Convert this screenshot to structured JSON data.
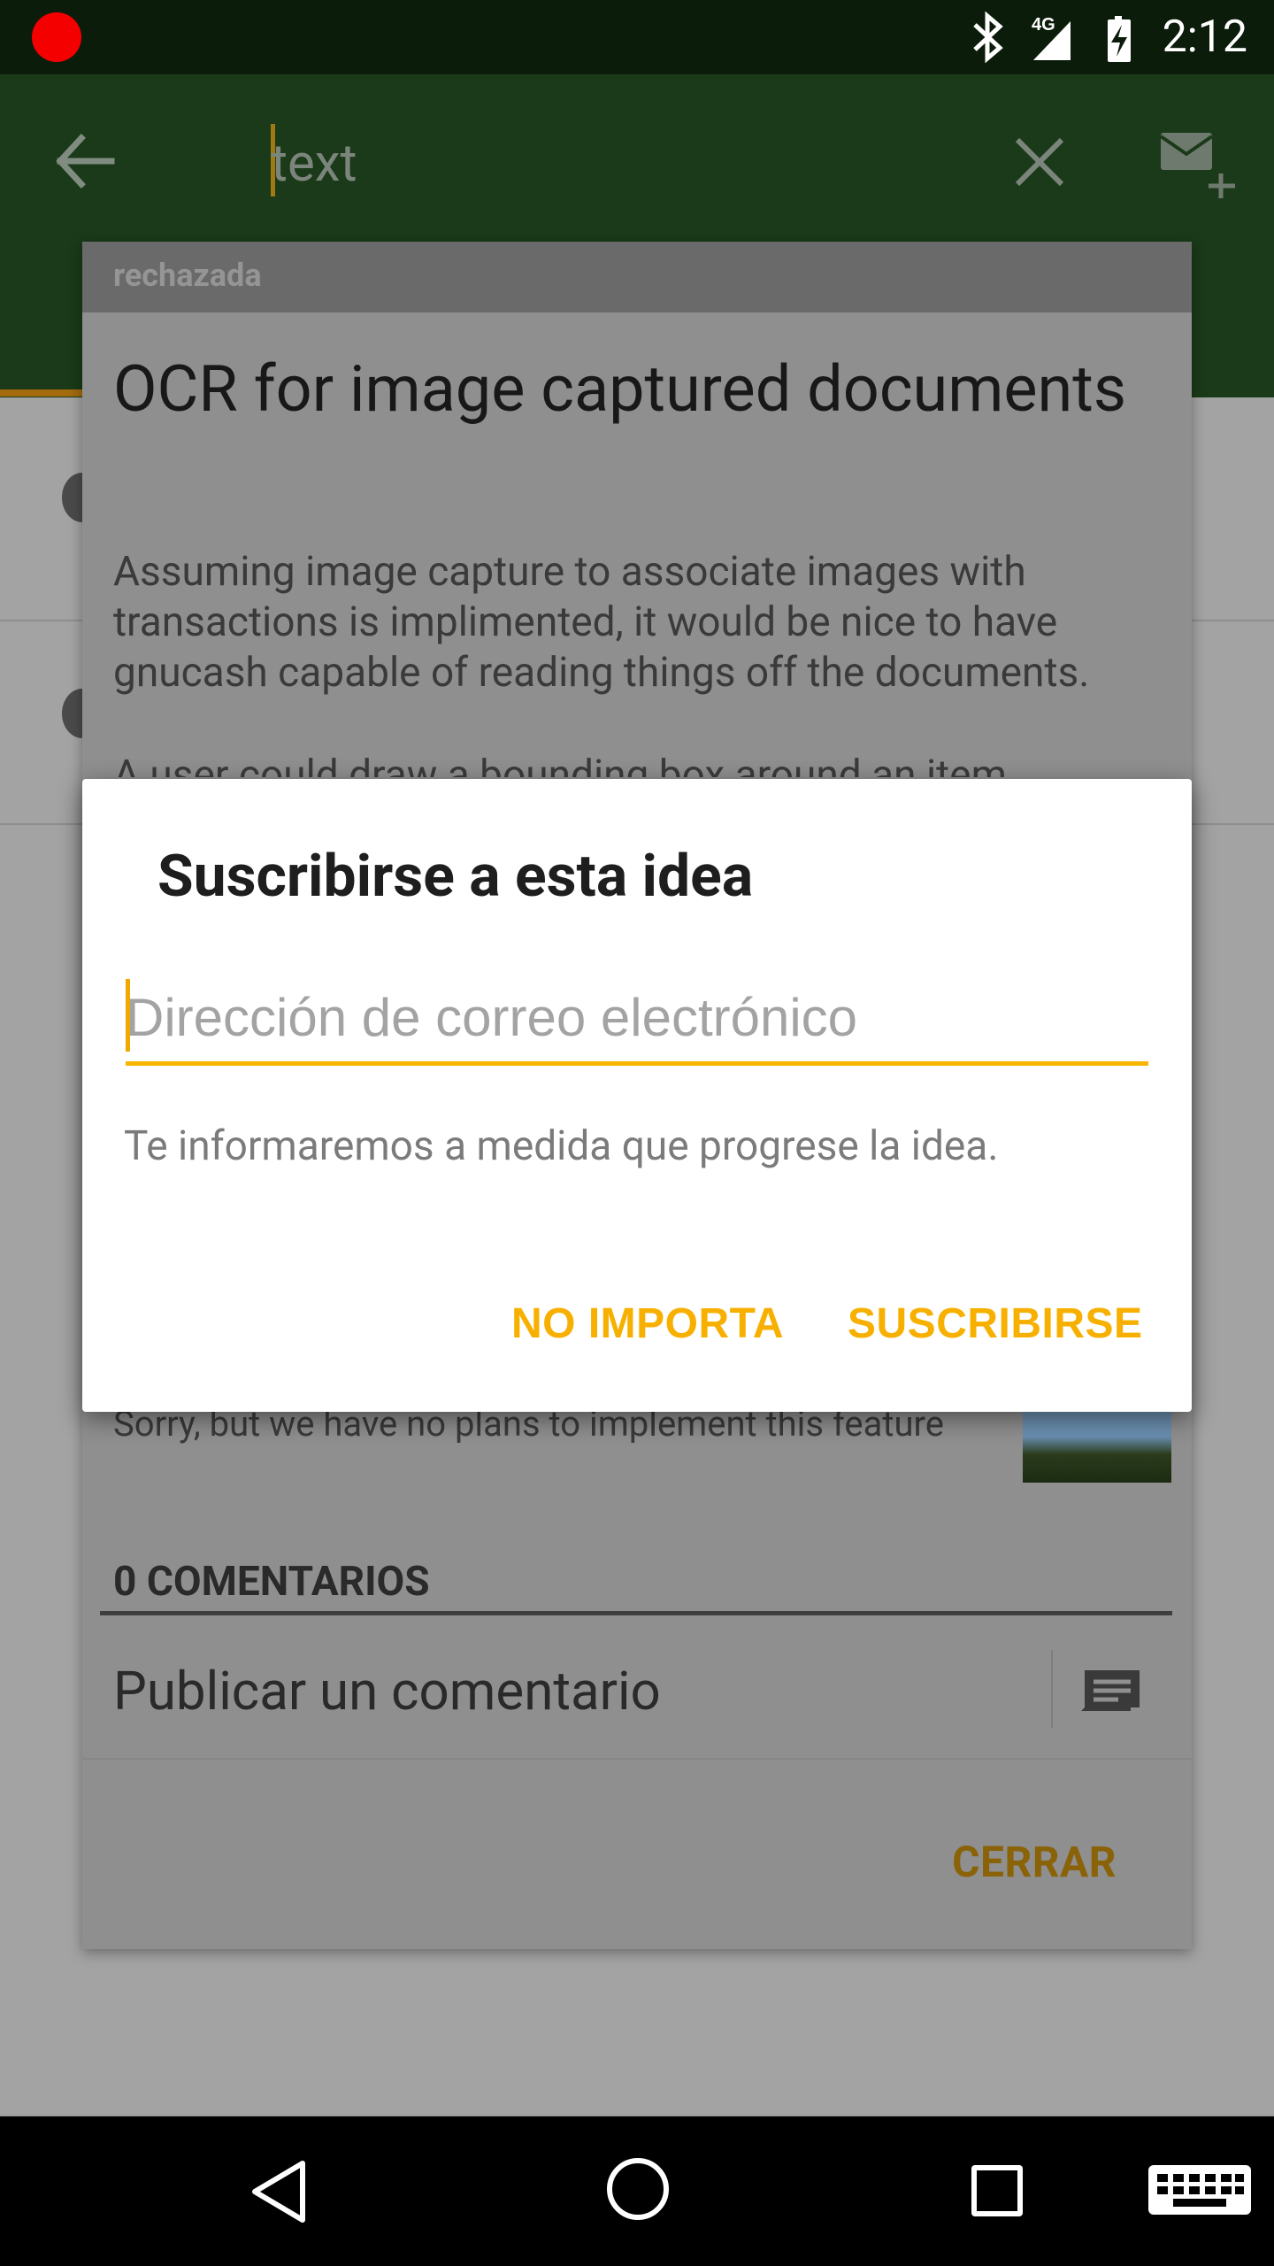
{
  "status_bar": {
    "time": "2:12",
    "network": "4G",
    "icons": [
      "record-dot-icon",
      "bluetooth-icon",
      "signal-icon",
      "battery-charging-icon"
    ]
  },
  "toolbar": {
    "search_value": "text",
    "icons": [
      "back-arrow-icon",
      "close-icon",
      "mail-add-icon"
    ]
  },
  "idea": {
    "status": "rechazada",
    "title": "OCR for image captured documents",
    "description": "Assuming image capture to associate images with transactions is implimented, it would be nice to have gnucash capable of reading things off the documents.",
    "description_more": "A user could draw a bounding box around an item",
    "reply": "Sorry, but we have no plans to implement this feature",
    "comments_header": "0 COMENTARIOS",
    "comment_placeholder": "Publicar un comentario",
    "close_label": "CERRAR"
  },
  "dialog": {
    "title": "Suscribirse a esta idea",
    "email_placeholder": "Dirección de correo electrónico",
    "email_value": "",
    "message": "Te informaremos a medida que progrese la idea.",
    "cancel_label": "NO IMPORTA",
    "confirm_label": "SUSCRIBIRSE"
  },
  "colors": {
    "accent": "#f7b500",
    "toolbar": "#1a3a19",
    "status_bar": "#0b1c0b"
  },
  "nav_bar": {
    "icons": [
      "nav-back-icon",
      "nav-home-icon",
      "nav-recents-icon",
      "keyboard-icon"
    ]
  }
}
